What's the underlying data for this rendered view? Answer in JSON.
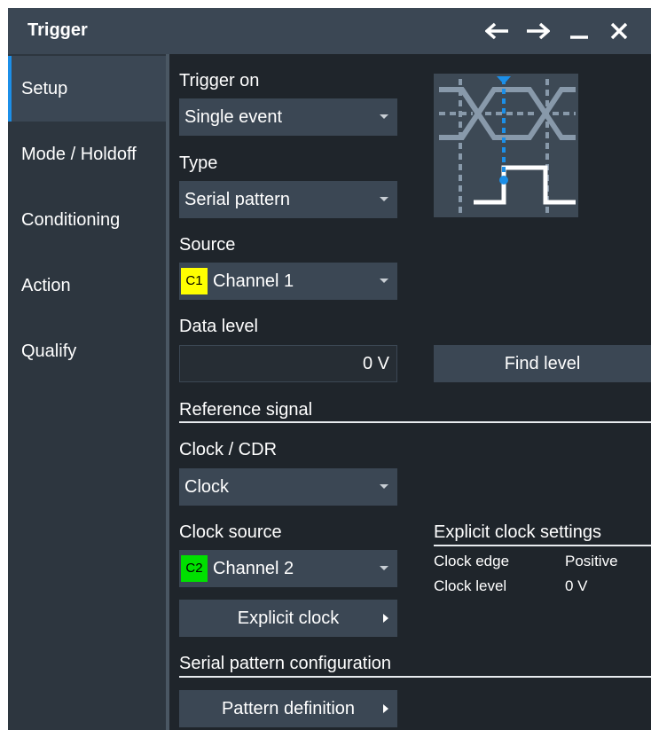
{
  "window": {
    "title": "Trigger"
  },
  "titlebar": {
    "back_icon": "arrow-left-icon",
    "forward_icon": "arrow-right-icon",
    "minimize_icon": "minimize-icon",
    "close_icon": "close-icon"
  },
  "sidebar": {
    "items": [
      {
        "label": "Setup",
        "active": true
      },
      {
        "label": "Mode / Holdoff",
        "active": false
      },
      {
        "label": "Conditioning",
        "active": false
      },
      {
        "label": "Action",
        "active": false
      },
      {
        "label": "Qualify",
        "active": false
      }
    ]
  },
  "trigger_on": {
    "label": "Trigger on",
    "value": "Single event"
  },
  "type": {
    "label": "Type",
    "value": "Serial pattern"
  },
  "source": {
    "label": "Source",
    "chip": "C1",
    "chip_color": "#ffff00",
    "value": "Channel 1"
  },
  "data_level": {
    "label": "Data level",
    "value": "0 V",
    "find_button": "Find level"
  },
  "reference_signal": {
    "heading": "Reference signal"
  },
  "clock_cdr": {
    "label": "Clock / CDR",
    "value": "Clock"
  },
  "clock_source": {
    "label": "Clock source",
    "chip": "C2",
    "chip_color": "#00e000",
    "value": "Channel 2"
  },
  "explicit_clock": {
    "button": "Explicit clock",
    "heading": "Explicit clock settings",
    "edge_label": "Clock edge",
    "edge_value": "Positive",
    "level_label": "Clock level",
    "level_value": "0 V"
  },
  "serial_pattern": {
    "heading": "Serial pattern configuration",
    "button": "Pattern definition"
  },
  "colors": {
    "accent": "#1c8fe8",
    "panel": "#3b4754",
    "background": "#1f252b"
  }
}
